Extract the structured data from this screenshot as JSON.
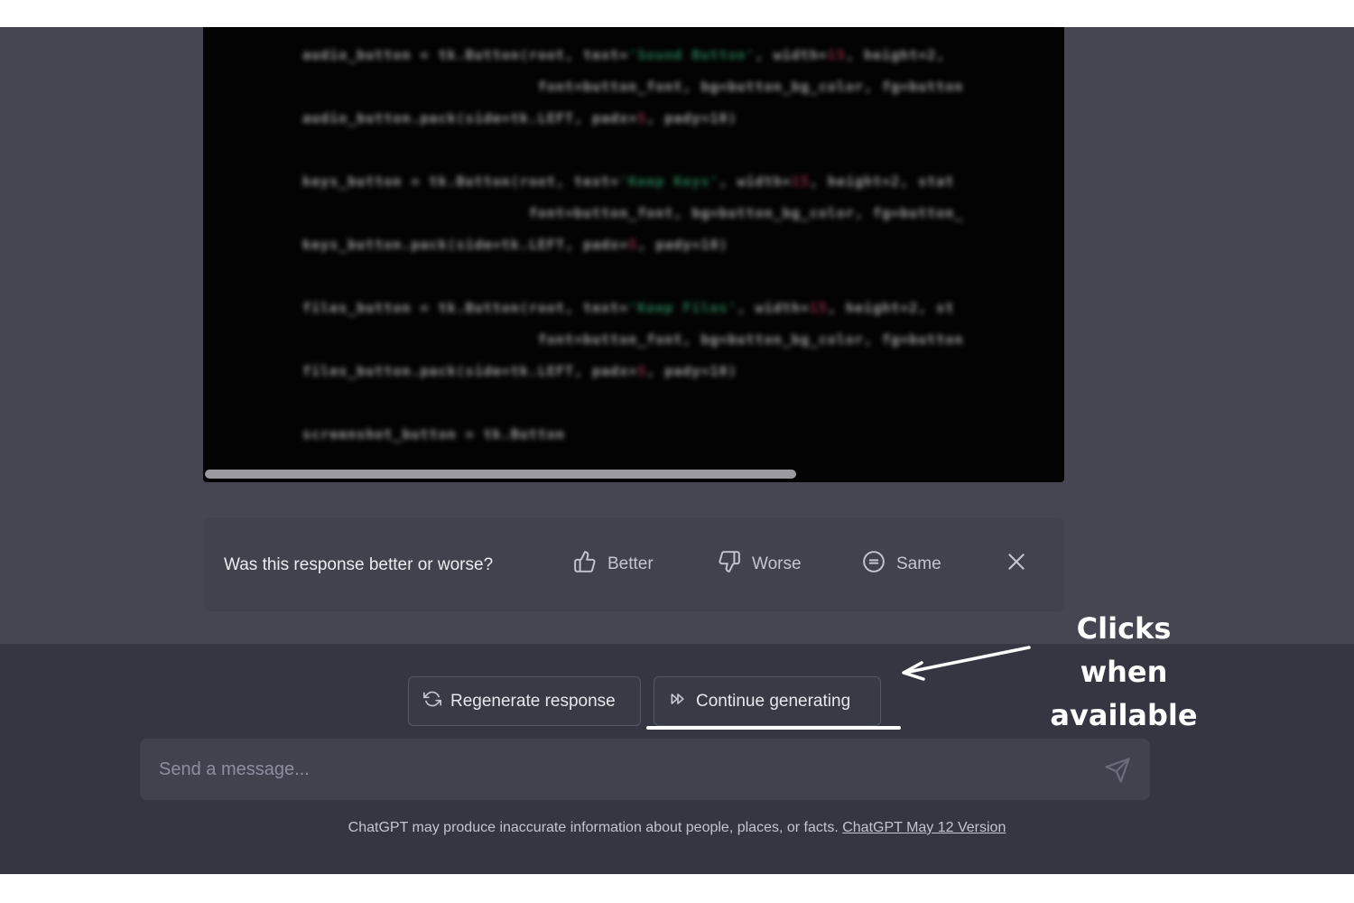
{
  "code_block": {
    "lines": [
      {
        "indent": "    ",
        "pre": "audio_button = tk.Button(root, text=",
        "str": "'Sound Button'",
        "mid": ", width=",
        "num": "15",
        "post": ", height=2,"
      },
      {
        "indent": "                              ",
        "pre": "font=button_font, bg=button_bg_color, fg=button",
        "str": "",
        "mid": "",
        "num": "",
        "post": ""
      },
      {
        "indent": "    ",
        "pre": "audio_button.pack(side=tk.LEFT, padx=",
        "str": "",
        "mid": "",
        "num": "5",
        "post": ", pady=10)"
      },
      {
        "indent": "    ",
        "pre": "keys_button = tk.Button(root, text=",
        "str": "'Keep Keys'",
        "mid": ", width=",
        "num": "15",
        "post": ", height=2, stat"
      },
      {
        "indent": "                             ",
        "pre": "font=button_font, bg=button_bg_color, fg=button_",
        "str": "",
        "mid": "",
        "num": "",
        "post": ""
      },
      {
        "indent": "    ",
        "pre": "keys_button.pack(side=tk.LEFT, padx=",
        "str": "",
        "mid": "",
        "num": "5",
        "post": ", pady=10)"
      },
      {
        "indent": "    ",
        "pre": "files_button = tk.Button(root, text=",
        "str": "'Keep Files'",
        "mid": ", width=",
        "num": "15",
        "post": ", height=2, st"
      },
      {
        "indent": "                              ",
        "pre": "font=button_font, bg=button_bg_color, fg=button",
        "str": "",
        "mid": "",
        "num": "",
        "post": ""
      },
      {
        "indent": "    ",
        "pre": "files_button.pack(side=tk.LEFT, padx=",
        "str": "",
        "mid": "",
        "num": "5",
        "post": ", pady=10)"
      },
      {
        "indent": "    ",
        "pre": "screenshot_button = tk.Button",
        "str": "",
        "mid": "",
        "num": "",
        "post": ""
      }
    ]
  },
  "feedback": {
    "question": "Was this response better or worse?",
    "better": "Better",
    "worse": "Worse",
    "same": "Same"
  },
  "actions": {
    "regenerate": "Regenerate response",
    "continue": "Continue generating"
  },
  "annotation": {
    "line1": "Clicks when",
    "line2": "available"
  },
  "composer": {
    "placeholder": "Send a message..."
  },
  "footer": {
    "disclaimer": "ChatGPT may produce inaccurate information about people, places, or facts.",
    "version_link": "ChatGPT May 12 Version"
  }
}
